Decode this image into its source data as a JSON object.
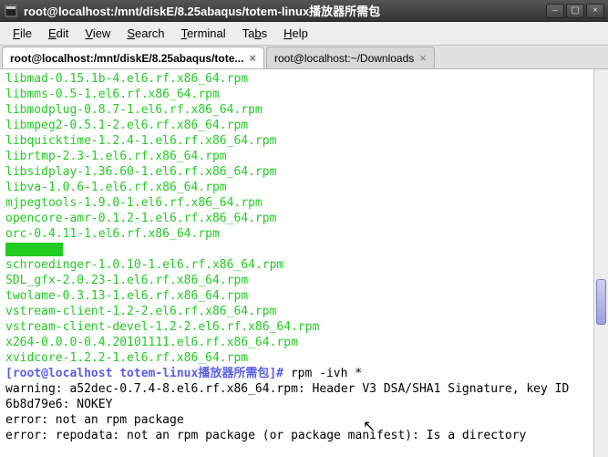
{
  "window": {
    "title": "root@localhost:/mnt/diskE/8.25abaqus/totem-linux播放器所需包"
  },
  "menu": {
    "file": "File",
    "edit": "Edit",
    "view": "View",
    "search": "Search",
    "terminal": "Terminal",
    "tabs": "Tabs",
    "help": "Help"
  },
  "tabs": [
    {
      "label": "root@localhost:/mnt/diskE/8.25abaqus/tote...",
      "active": true
    },
    {
      "label": "root@localhost:~/Downloads",
      "active": false
    }
  ],
  "terminal": {
    "files": [
      "libmad-0.15.1b-4.el6.rf.x86_64.rpm",
      "libmms-0.5-1.el6.rf.x86_64.rpm",
      "libmodplug-0.8.7-1.el6.rf.x86_64.rpm",
      "libmpeg2-0.5.1-2.el6.rf.x86_64.rpm",
      "libquicktime-1.2.4-1.el6.rf.x86_64.rpm",
      "librtmp-2.3-1.el6.rf.x86_64.rpm",
      "libsidplay-1.36.60-1.el6.rf.x86_64.rpm",
      "libva-1.0.6-1.el6.rf.x86_64.rpm",
      "mjpegtools-1.9.0-1.el6.rf.x86_64.rpm",
      "opencore-amr-0.1.2-1.el6.rf.x86_64.rpm",
      "orc-0.4.11-1.el6.rf.x86_64.rpm"
    ],
    "highlighted": "repodata",
    "files2": [
      "schroedinger-1.0.10-1.el6.rf.x86_64.rpm",
      "SDL_gfx-2.0.23-1.el6.rf.x86_64.rpm",
      "twolame-0.3.13-1.el6.rf.x86_64.rpm",
      "vstream-client-1.2-2.el6.rf.x86_64.rpm",
      "vstream-client-devel-1.2-2.el6.rf.x86_64.rpm",
      "x264-0.0.0-0.4.20101111.el6.rf.x86_64.rpm",
      "xvidcore-1.2.2-1.el6.rf.x86_64.rpm"
    ],
    "prompt": "[root@localhost totem-linux播放器所需包]# ",
    "command": "rpm -ivh *",
    "output": [
      "warning: a52dec-0.7.4-8.el6.rf.x86_64.rpm: Header V3 DSA/SHA1 Signature, key ID",
      "6b8d79e6: NOKEY",
      "error: not an rpm package",
      "error: repodata: not an rpm package (or package manifest): Is a directory"
    ]
  }
}
